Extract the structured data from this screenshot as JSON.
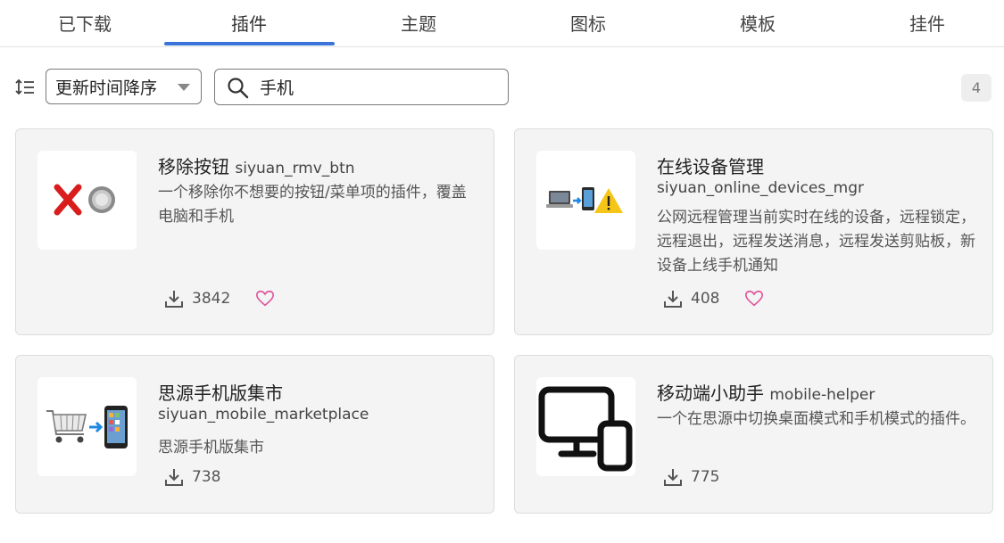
{
  "tabs": [
    {
      "label": "已下载"
    },
    {
      "label": "插件"
    },
    {
      "label": "主题"
    },
    {
      "label": "图标"
    },
    {
      "label": "模板"
    },
    {
      "label": "挂件"
    }
  ],
  "active_tab": "插件",
  "toolbar": {
    "sort_label": "更新时间降序",
    "search_value": "手机",
    "result_count": "4"
  },
  "cards": [
    {
      "title": "移除按钮",
      "package": "siyuan_rmv_btn",
      "description": "一个移除你不想要的按钮/菜单项的插件，覆盖电脑和手机",
      "downloads": "3842",
      "icon": "remove-button-icon"
    },
    {
      "title": "在线设备管理",
      "package": "siyuan_online_devices_mgr",
      "description": "公网远程管理当前实时在线的设备，远程锁定，远程退出，远程发送消息，远程发送剪贴板，新设备上线手机通知",
      "downloads": "408",
      "icon": "devices-warning-icon"
    },
    {
      "title": "思源手机版集市",
      "package": "siyuan_mobile_marketplace",
      "description": "思源手机版集市",
      "downloads": "738",
      "icon": "cart-to-phone-icon"
    },
    {
      "title": "移动端小助手",
      "package": "mobile-helper",
      "description": "一个在思源中切换桌面模式和手机模式的插件。",
      "downloads": "775",
      "icon": "desktop-mobile-icon"
    }
  ],
  "colors": {
    "accent": "#3a74d8",
    "heart": "#e0559b",
    "card_bg": "#f4f4f4"
  }
}
